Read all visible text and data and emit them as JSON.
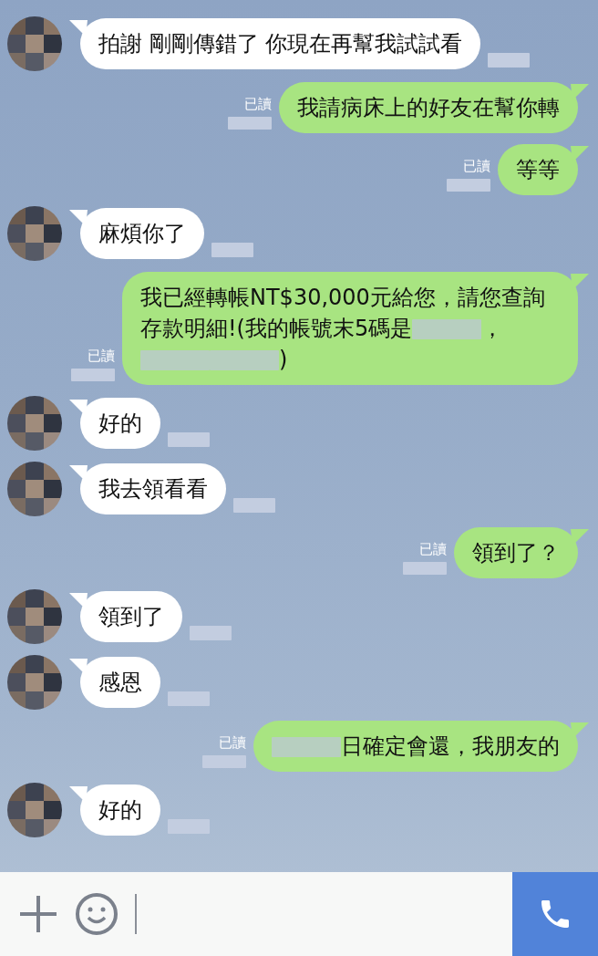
{
  "messages": [
    {
      "kind": "received",
      "parts": [
        {
          "kind": "text",
          "text": "拍謝 剛剛傳錯了 你現在再幫我試試看"
        }
      ]
    },
    {
      "kind": "sent",
      "read": "已讀",
      "parts": [
        {
          "kind": "text",
          "text": "我請病床上的好友在幫你轉"
        }
      ]
    },
    {
      "kind": "sent",
      "read": "已讀",
      "parts": [
        {
          "kind": "text",
          "text": "等等"
        }
      ]
    },
    {
      "kind": "received",
      "parts": [
        {
          "kind": "text",
          "text": "麻煩你了"
        }
      ]
    },
    {
      "kind": "sent",
      "read": "已讀",
      "parts": [
        {
          "kind": "text",
          "text": "我已經轉帳NT$30,000元給您，請您查詢存款明細!(我的帳號末5碼是"
        },
        {
          "kind": "redacted"
        },
        {
          "kind": "text",
          "text": "，"
        },
        {
          "kind": "redacted"
        },
        {
          "kind": "redacted"
        },
        {
          "kind": "text",
          "text": ")"
        }
      ]
    },
    {
      "kind": "received",
      "parts": [
        {
          "kind": "text",
          "text": "好的"
        }
      ]
    },
    {
      "kind": "received",
      "parts": [
        {
          "kind": "text",
          "text": "我去領看看"
        }
      ]
    },
    {
      "kind": "sent",
      "read": "已讀",
      "parts": [
        {
          "kind": "text",
          "text": "領到了？"
        }
      ]
    },
    {
      "kind": "received",
      "parts": [
        {
          "kind": "text",
          "text": "領到了"
        }
      ]
    },
    {
      "kind": "received",
      "parts": [
        {
          "kind": "text",
          "text": "感恩"
        }
      ]
    },
    {
      "kind": "sent",
      "read": "已讀",
      "parts": [
        {
          "kind": "redacted"
        },
        {
          "kind": "text",
          "text": "日確定會還，我朋友的"
        }
      ]
    },
    {
      "kind": "received",
      "parts": [
        {
          "kind": "text",
          "text": "好的"
        }
      ]
    }
  ]
}
